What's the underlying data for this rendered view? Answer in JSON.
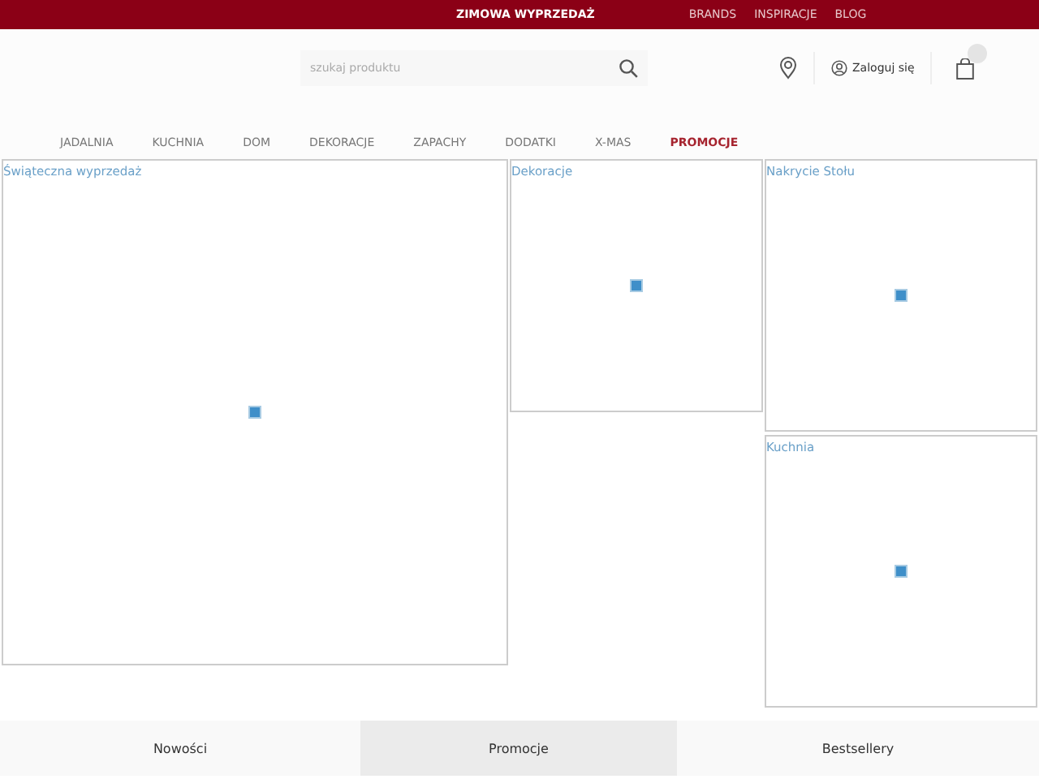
{
  "top_bar": {
    "promo": "ZIMOWA WYPRZEDAŻ",
    "links": [
      "BRANDS",
      "INSPIRACJE",
      "BLOG"
    ]
  },
  "header": {
    "search": {
      "placeholder": "szukaj produktu"
    },
    "login": "Zaloguj się"
  },
  "nav": [
    {
      "label": "JADALNIA",
      "selected": false
    },
    {
      "label": "KUCHNIA",
      "selected": false
    },
    {
      "label": "DOM",
      "selected": false
    },
    {
      "label": "DEKORACJE",
      "selected": false
    },
    {
      "label": "ZAPACHY",
      "selected": false
    },
    {
      "label": "DODATKI",
      "selected": false
    },
    {
      "label": "X-MAS",
      "selected": false
    },
    {
      "label": "PROMOCJE",
      "selected": true
    }
  ],
  "tile_columns": [
    {
      "tiles": [
        {
          "title": "Świąteczna wyprzedaż"
        }
      ]
    },
    {
      "tiles": [
        {
          "title": "Dekoracje"
        }
      ]
    },
    {
      "tiles": [
        {
          "title": "Nakrycie Stołu"
        },
        {
          "title": "Kuchnia"
        }
      ]
    }
  ],
  "bottom_tabs": [
    {
      "label": "Nowości",
      "selected": false
    },
    {
      "label": "Promocje",
      "selected": true
    },
    {
      "label": "Bestsellery",
      "selected": false
    }
  ]
}
